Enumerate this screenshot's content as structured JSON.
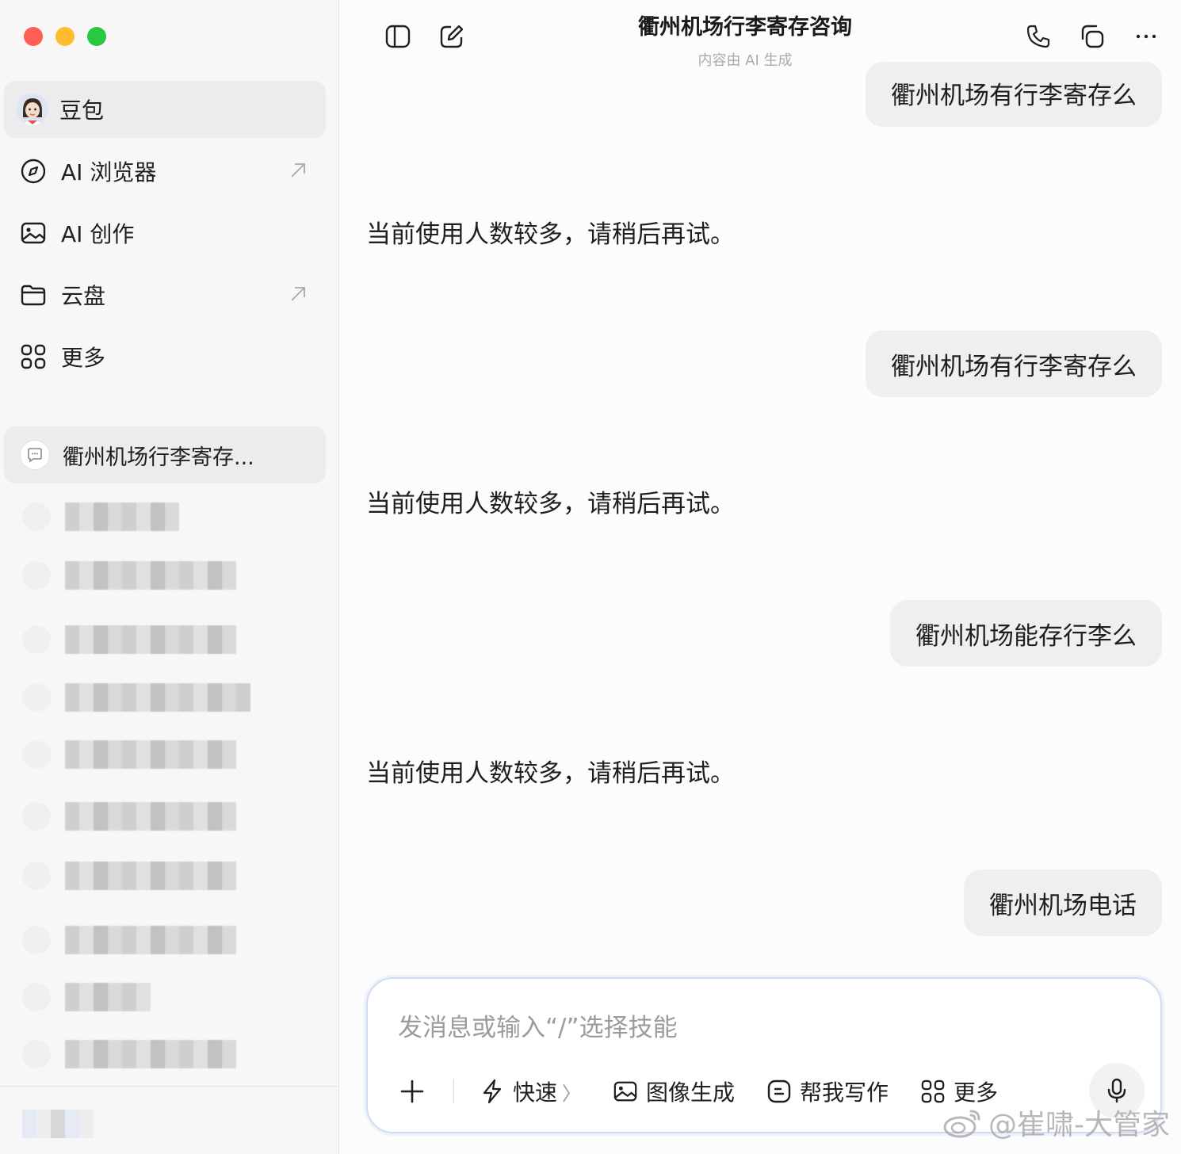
{
  "sidebar": {
    "nav": [
      {
        "label": "豆包",
        "icon": "doubao-avatar"
      },
      {
        "label": "AI 浏览器",
        "icon": "compass-icon",
        "external": true
      },
      {
        "label": "AI 创作",
        "icon": "image-icon"
      },
      {
        "label": "云盘",
        "icon": "folder-icon",
        "external": true
      },
      {
        "label": "更多",
        "icon": "grid-icon"
      }
    ],
    "active_conversation": "衢州机场行李寄存..."
  },
  "header": {
    "title": "衢州机场行李寄存咨询",
    "subtitle": "内容由 AI 生成"
  },
  "messages": [
    {
      "role": "user",
      "text": "衢州机场有行李寄存么"
    },
    {
      "role": "assistant",
      "text": "当前使用人数较多，请稍后再试。"
    },
    {
      "role": "user",
      "text": "衢州机场有行李寄存么"
    },
    {
      "role": "assistant",
      "text": "当前使用人数较多，请稍后再试。"
    },
    {
      "role": "user",
      "text": "衢州机场能存行李么"
    },
    {
      "role": "assistant",
      "text": "当前使用人数较多，请稍后再试。"
    },
    {
      "role": "user",
      "text": "衢州机场电话"
    }
  ],
  "composer": {
    "placeholder": "发消息或输入“/”选择技能",
    "tools": {
      "fast": "快速",
      "image_gen": "图像生成",
      "write": "帮我写作",
      "more": "更多"
    }
  },
  "watermark": "@崔啸-大管家",
  "colors": {
    "red": "#fe5f57",
    "yellow": "#febc2e",
    "green": "#28c840",
    "bubble": "#efefef",
    "input_border": "#cfdcf3"
  }
}
